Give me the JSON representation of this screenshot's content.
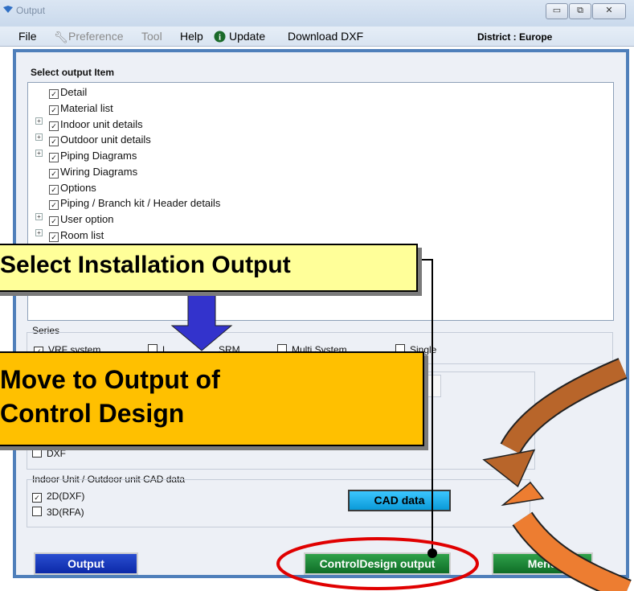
{
  "window": {
    "title": "Output",
    "controls": {
      "minimize": "▭",
      "maximize": "⧉",
      "close": "✕"
    }
  },
  "menu": {
    "file": "File",
    "preference": "Preference",
    "tool": "Tool",
    "help": "Help",
    "update": "Update",
    "download_dxf": "Download DXF",
    "district": "District : Europe"
  },
  "select_output": {
    "title": "Select output Item",
    "items": [
      {
        "label": "Detail",
        "expandable": false
      },
      {
        "label": "Material list",
        "expandable": true
      },
      {
        "label": "Indoor unit details",
        "expandable": true
      },
      {
        "label": "Outdoor unit details",
        "expandable": true
      },
      {
        "label": "Piping Diagrams",
        "expandable": false
      },
      {
        "label": "Wiring Diagrams",
        "expandable": false
      },
      {
        "label": "Options",
        "expandable": false
      },
      {
        "label": "Piping / Branch kit / Header details",
        "expandable": true
      },
      {
        "label": "User option",
        "expandable": true
      },
      {
        "label": "Room list",
        "expandable": true
      }
    ]
  },
  "series": {
    "title": "Series",
    "options": [
      {
        "label": "VRF system",
        "checked": true
      },
      {
        "label": "L",
        "checked": false
      },
      {
        "label": "SRM",
        "checked": false
      },
      {
        "label": "Multi System",
        "checked": false
      },
      {
        "label": "Single",
        "checked": false
      }
    ]
  },
  "dxf": {
    "label": "DXF",
    "checked": false
  },
  "cad_data": {
    "title": "Indoor Unit / Outdoor unit CAD data",
    "options": [
      {
        "label": "2D(DXF)",
        "checked": true
      },
      {
        "label": "3D(RFA)",
        "checked": false
      }
    ],
    "button": "CAD data"
  },
  "buttons": {
    "output": "Output",
    "control_design": "ControlDesign output",
    "menu": "Menu"
  },
  "callouts": {
    "select_installation": "Select Installation Output",
    "move_to_output": "Move to Output of",
    "control_design": "Control Design"
  },
  "colors": {
    "panel_border": "#4f7fba",
    "callout_light_yellow": "#ffff99",
    "callout_orange": "#ffc000",
    "arrow_blue": "#3333cc",
    "arrow_brown": "#b8652a",
    "arrow_orange": "#ed7d31",
    "highlight_red": "#e00000"
  }
}
